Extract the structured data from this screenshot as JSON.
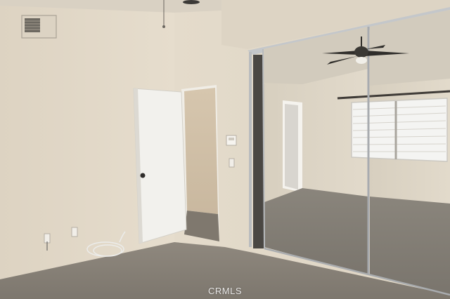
{
  "photo": {
    "subject": "empty-bedroom-mirrored-closet",
    "watermark_text": "CRMLS"
  },
  "colors": {
    "wall": "#e3d9c8",
    "ceiling": "#d9d1c3",
    "carpet": "#8a8379",
    "door": "#f2f1ed",
    "mirror_frame": "#b9bcbf"
  },
  "icons": [
    "hvac-vent-icon",
    "ceiling-fan-icon",
    "thermostat-icon",
    "outlet-icon",
    "light-switch-icon",
    "door-knob-icon"
  ]
}
